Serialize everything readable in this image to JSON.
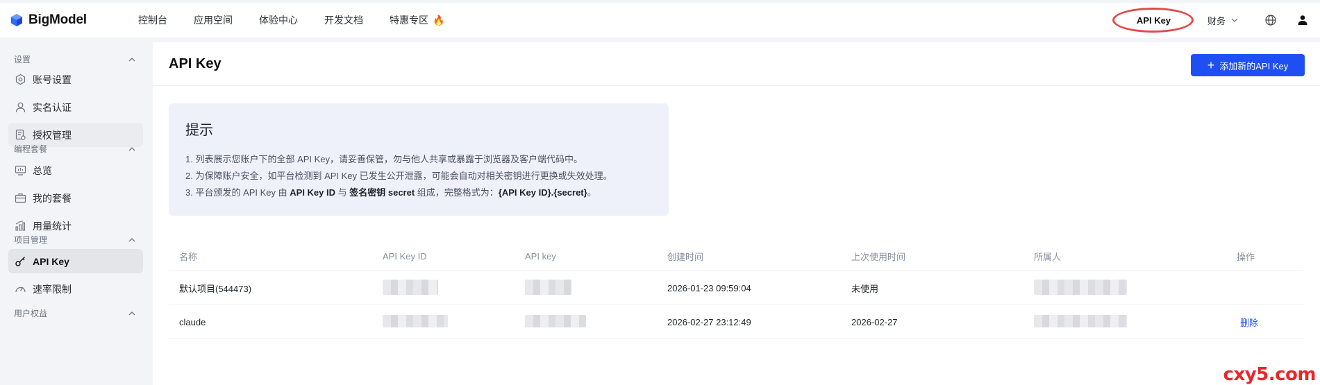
{
  "brand": {
    "name": "BigModel"
  },
  "topnav": {
    "items": [
      "控制台",
      "应用空间",
      "体验中心",
      "开发文档",
      "特惠专区"
    ],
    "api_key_link": "API Key",
    "finance": "财务"
  },
  "sidebar": {
    "groups": [
      {
        "title": "设置",
        "items": [
          "账号设置",
          "实名认证",
          "授权管理"
        ]
      },
      {
        "title": "编程套餐",
        "items": [
          "总览",
          "我的套餐",
          "用量统计"
        ]
      },
      {
        "title": "项目管理",
        "items": [
          "API Key",
          "速率限制"
        ]
      },
      {
        "title": "用户权益",
        "items": []
      }
    ]
  },
  "page": {
    "title": "API Key",
    "add_button": "添加新的API Key"
  },
  "tip": {
    "title": "提示",
    "line1": "1. 列表展示您账户下的全部 API Key，请妥善保管，勿与他人共享或暴露于浏览器及客户端代码中。",
    "line2": "2. 为保障账户安全，如平台检测到 API Key 已发生公开泄露，可能会自动对相关密钥进行更换或失效处理。",
    "line3_a": "3. 平台颁发的 API Key 由 ",
    "line3_b": "API Key ID",
    "line3_c": " 与 ",
    "line3_d": "签名密钥 secret",
    "line3_e": " 组成，完整格式为：",
    "line3_f": "{API Key ID}.{secret}",
    "line3_g": "。"
  },
  "table": {
    "headers": [
      "名称",
      "API Key ID",
      "API key",
      "创建时间",
      "上次使用时间",
      "所属人",
      "操作"
    ],
    "rows": [
      {
        "name": "默认项目(544473)",
        "created": "2026-01-23 09:59:04",
        "last_used": "未使用",
        "action": ""
      },
      {
        "name": "claude",
        "created": "2026-02-27 23:12:49",
        "last_used": "2026-02-27",
        "action": "删除"
      }
    ]
  },
  "watermark": "cxy5.com",
  "colors": {
    "accent": "#1f4ff2",
    "highlight_ring": "#e24a4a",
    "tip_bg": "#eef1fa"
  }
}
